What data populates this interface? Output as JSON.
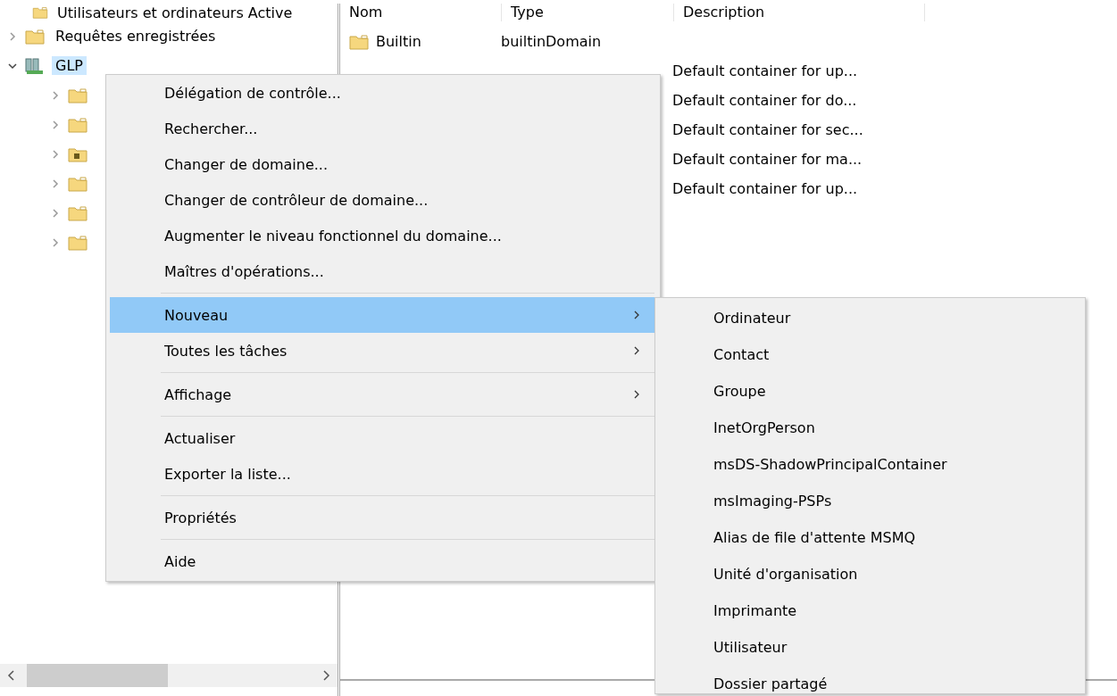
{
  "tree": {
    "root": "Utilisateurs et ordinateurs Active",
    "items": [
      {
        "label": "Requêtes enregistrées",
        "kind": "folder",
        "expanded": false,
        "selected": false
      },
      {
        "label": "GLP",
        "kind": "domain",
        "expanded": true,
        "selected": true,
        "children": [
          {
            "kind": "folder",
            "expanded": false
          },
          {
            "kind": "folder",
            "expanded": false
          },
          {
            "kind": "special",
            "expanded": false
          },
          {
            "kind": "folder",
            "expanded": false
          },
          {
            "kind": "folder",
            "expanded": false
          },
          {
            "kind": "folder",
            "expanded": false
          }
        ]
      }
    ]
  },
  "list": {
    "columns": [
      "Nom",
      "Type",
      "Description"
    ],
    "rows": [
      {
        "name": "Builtin",
        "type": "builtinDomain"
      },
      {
        "description": "Default container for up..."
      },
      {
        "description": "Default container for do..."
      },
      {
        "description": "Default container for sec..."
      },
      {
        "description": "Default container for ma..."
      },
      {
        "description": "Default container for up..."
      }
    ]
  },
  "context_menu": {
    "items": [
      {
        "kind": "item",
        "label": "Délégation de contrôle...",
        "submenu": false,
        "selected": false
      },
      {
        "kind": "item",
        "label": "Rechercher...",
        "submenu": false,
        "selected": false
      },
      {
        "kind": "item",
        "label": "Changer de domaine...",
        "submenu": false,
        "selected": false
      },
      {
        "kind": "item",
        "label": "Changer de contrôleur de domaine...",
        "submenu": false,
        "selected": false
      },
      {
        "kind": "item",
        "label": "Augmenter le niveau fonctionnel du domaine...",
        "submenu": false,
        "selected": false
      },
      {
        "kind": "item",
        "label": "Maîtres d'opérations...",
        "submenu": false,
        "selected": false
      },
      {
        "kind": "separator"
      },
      {
        "kind": "item",
        "label": "Nouveau",
        "submenu": true,
        "selected": true
      },
      {
        "kind": "item",
        "label": "Toutes les tâches",
        "submenu": true,
        "selected": false
      },
      {
        "kind": "separator"
      },
      {
        "kind": "item",
        "label": "Affichage",
        "submenu": true,
        "selected": false
      },
      {
        "kind": "separator"
      },
      {
        "kind": "item",
        "label": "Actualiser",
        "submenu": false,
        "selected": false
      },
      {
        "kind": "item",
        "label": "Exporter la liste...",
        "submenu": false,
        "selected": false
      },
      {
        "kind": "separator"
      },
      {
        "kind": "item",
        "label": "Propriétés",
        "submenu": false,
        "selected": false
      },
      {
        "kind": "separator"
      },
      {
        "kind": "item",
        "label": "Aide",
        "submenu": false,
        "selected": false
      }
    ]
  },
  "submenu": {
    "items": [
      "Ordinateur",
      "Contact",
      "Groupe",
      "InetOrgPerson",
      "msDS-ShadowPrincipalContainer",
      "msImaging-PSPs",
      "Alias de file d'attente MSMQ",
      "Unité d'organisation",
      "Imprimante",
      "Utilisateur",
      "Dossier partagé"
    ]
  }
}
